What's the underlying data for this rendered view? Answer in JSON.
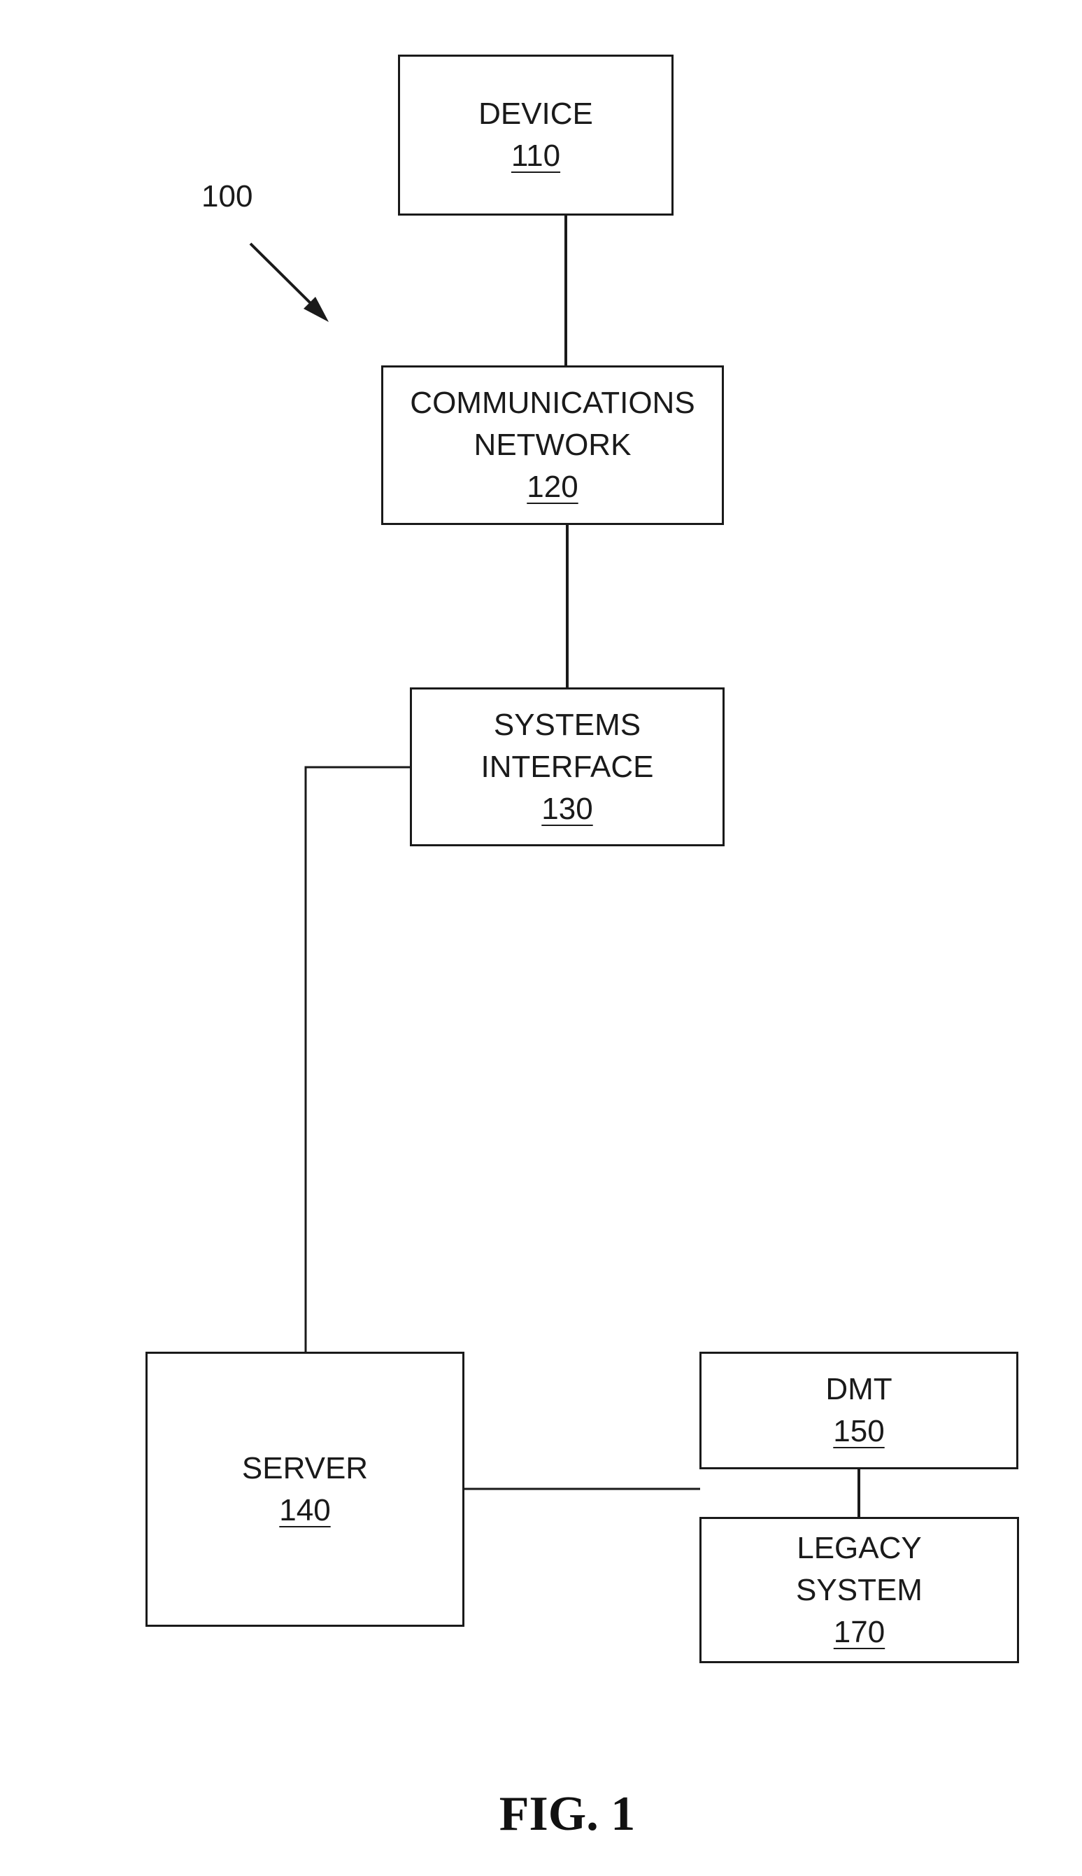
{
  "figure": {
    "reference_label": "100",
    "caption": "FIG. 1"
  },
  "nodes": {
    "device": {
      "lines": [
        "DEVICE"
      ],
      "ref": "110"
    },
    "communications_network": {
      "lines": [
        "COMMUNICATIONS",
        "NETWORK"
      ],
      "ref": "120"
    },
    "systems_interface": {
      "lines": [
        "SYSTEMS",
        "INTERFACE"
      ],
      "ref": "130"
    },
    "server": {
      "lines": [
        "SERVER"
      ],
      "ref": "140"
    },
    "dmt": {
      "lines": [
        "DMT"
      ],
      "ref": "150"
    },
    "legacy_system": {
      "lines": [
        "LEGACY",
        "SYSTEM"
      ],
      "ref": "170"
    }
  },
  "edges": [
    {
      "from": "device",
      "to": "communications_network"
    },
    {
      "from": "communications_network",
      "to": "systems_interface"
    },
    {
      "from": "systems_interface",
      "to": "server"
    },
    {
      "from": "server",
      "to": "dmt"
    },
    {
      "from": "dmt",
      "to": "legacy_system"
    }
  ],
  "colors": {
    "line": "#1a1a1a",
    "background": "#ffffff"
  }
}
